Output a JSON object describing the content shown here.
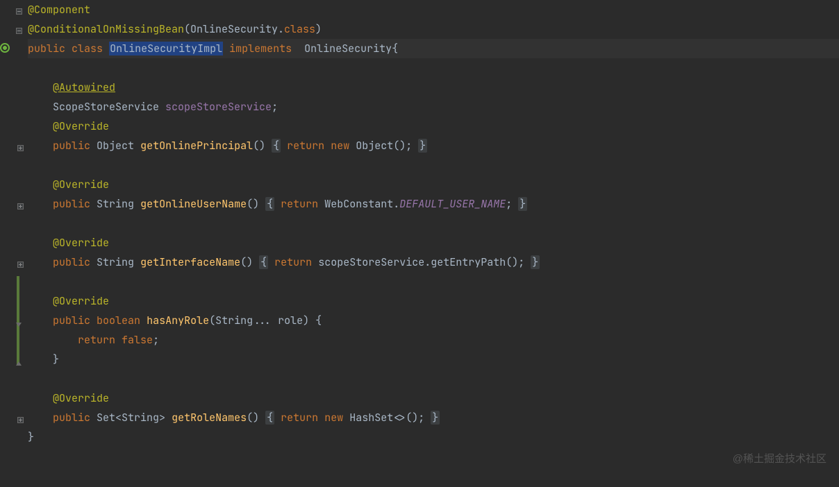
{
  "code": {
    "l1_anno": "@Component",
    "l2_anno": "@ConditionalOnMissingBean",
    "l2_p1": "(OnlineSecurity.",
    "l2_kw": "class",
    "l2_p2": ")",
    "l3_kw1": "public",
    "l3_kw2": "class",
    "l3_name": "OnlineSecurityImpl",
    "l3_impl": "implements",
    "l3_intf": "OnlineSecurity{",
    "l5_anno": "@Autowired",
    "l6_type": "ScopeStoreService",
    "l6_field": "scopeStoreService",
    "semi": ";",
    "override": "@Override",
    "kw_public": "public",
    "kw_return": "return",
    "kw_new": "new",
    "kw_boolean": "boolean",
    "kw_false": "false",
    "l8_ret": "Object",
    "l8_m": "getOnlinePrincipal",
    "l8_call": "Object();",
    "l11_ret": "String",
    "l11_m": "getOnlineUserName",
    "l11_expr1": "WebConstant.",
    "l11_const": "DEFAULT_USER_NAME",
    "l14_ret": "String",
    "l14_m": "getInterfaceName",
    "l14_expr": "scopeStoreService.getEntryPath();",
    "l17_m": "hasAnyRole",
    "l17_params": "(String... role) {",
    "l22_ret": "Set<String>",
    "l22_m": "getRoleNames",
    "l22_expr": "HashSet<>();",
    "lbrace": "{",
    "rbrace": "}",
    "parens": "()",
    "rbrace_semi": ";"
  },
  "watermark": "@稀土掘金技术社区"
}
